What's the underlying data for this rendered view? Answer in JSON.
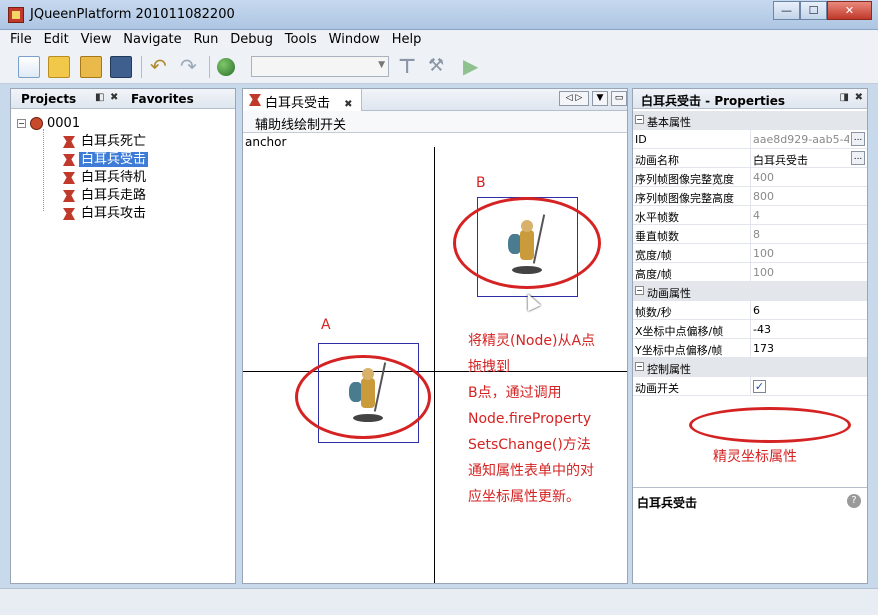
{
  "window": {
    "title": "JQueenPlatform 201011082200"
  },
  "menu": [
    "File",
    "Edit",
    "View",
    "Navigate",
    "Run",
    "Debug",
    "Tools",
    "Window",
    "Help"
  ],
  "toolbar": {
    "icons": [
      "new-file-icon",
      "new-project-icon",
      "open-project-icon",
      "save-all-icon",
      "undo-icon",
      "redo-icon",
      "globe-icon",
      "build-icon",
      "clean-build-icon",
      "run-icon"
    ],
    "config_combo_value": ""
  },
  "projects_panel": {
    "tab_projects": "Projects",
    "tab_favorites": "Favorites",
    "root": "0001",
    "items": [
      "白耳兵死亡",
      "白耳兵受击",
      "白耳兵待机",
      "白耳兵走路",
      "白耳兵攻击"
    ],
    "selected_index": 1
  },
  "editor": {
    "tab_title": "白耳兵受击",
    "toggle_button": "辅助线绘制开关",
    "anchor_label": "anchor",
    "label_a": "A",
    "label_b": "B",
    "annotation_lines": [
      "将精灵(Node)从A点",
      "拖拽到",
      "B点，通过调用",
      "Node.fireProperty",
      "SetsChange()方法",
      "通知属性表单中的对",
      "应坐标属性更新。"
    ]
  },
  "properties": {
    "title": "白耳兵受击 - Properties",
    "categories": [
      {
        "label": "基本属性",
        "rows": [
          {
            "name": "ID",
            "value": "aae8d929-aab5-4...",
            "muted": true,
            "dots": true
          },
          {
            "name": "动画名称",
            "value": "白耳兵受击",
            "muted": false,
            "dots": true
          },
          {
            "name": "序列帧图像完整宽度",
            "value": "400",
            "muted": true
          },
          {
            "name": "序列帧图像完整高度",
            "value": "800",
            "muted": true
          },
          {
            "name": "水平帧数",
            "value": "4",
            "muted": true
          },
          {
            "name": "垂直帧数",
            "value": "8",
            "muted": true
          },
          {
            "name": "宽度/帧",
            "value": "100",
            "muted": true
          },
          {
            "name": "高度/帧",
            "value": "100",
            "muted": true
          }
        ]
      },
      {
        "label": "动画属性",
        "rows": [
          {
            "name": "帧数/秒",
            "value": "6",
            "muted": false
          },
          {
            "name": "X坐标中点偏移/帧",
            "value": "-43",
            "muted": false
          },
          {
            "name": "Y坐标中点偏移/帧",
            "value": "173",
            "muted": false
          }
        ]
      },
      {
        "label": "控制属性",
        "rows": [
          {
            "name": "动画开关",
            "checkbox": true,
            "checked": true
          }
        ]
      }
    ],
    "help_title": "白耳兵受击",
    "annotation": "精灵坐标属性"
  },
  "colors": {
    "annotation_red": "#d52323",
    "selection_blue": "#3d7bd6",
    "sprite_box": "#2e2ea6"
  }
}
